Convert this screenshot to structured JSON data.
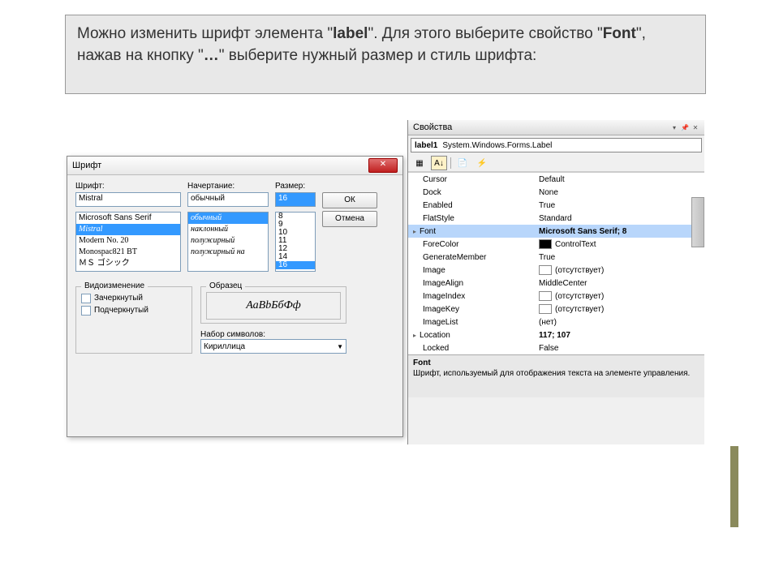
{
  "instruction": {
    "text_before_bold1": "Можно изменить шрифт элемента \"",
    "bold1": "label",
    "text_after_bold1": "\". Для этого выберите свойство \"",
    "bold2": "Font",
    "text_after_bold2": "\", нажав на кнопку \"",
    "bold3": "…",
    "text_end": "\" выберите нужный размер и стиль шрифта:"
  },
  "fontDialog": {
    "title": "Шрифт",
    "fontLabel": "Шрифт:",
    "styleLabel": "Начертание:",
    "sizeLabel": "Размер:",
    "fontInput": "Mistral",
    "styleInput": "обычный",
    "sizeInput": "16",
    "fontList": [
      "Microsoft Sans Serif",
      "Mistral",
      "Modern No. 20",
      "Monospac821 BT",
      "ＭＳ ゴシック"
    ],
    "fontListSelIndex": 1,
    "styleList": [
      "обычный",
      "наклонный",
      "полужирный",
      "полужирный на"
    ],
    "styleListSelIndex": 0,
    "sizeList": [
      "8",
      "9",
      "10",
      "11",
      "12",
      "14",
      "16"
    ],
    "sizeListSelIndex": 6,
    "okBtn": "ОК",
    "cancelBtn": "Отмена",
    "effectsGroup": "Видоизменение",
    "strikeout": "Зачеркнутый",
    "underline": "Подчеркнутый",
    "sampleGroup": "Образец",
    "sampleText": "АаВbБбФф",
    "scriptLabel": "Набор символов:",
    "scriptValue": "Кириллица"
  },
  "properties": {
    "title": "Свойства",
    "selector": {
      "name": "label1",
      "type": "System.Windows.Forms.Label"
    },
    "rows": [
      {
        "name": "Cursor",
        "val": "Default"
      },
      {
        "name": "Dock",
        "val": "None"
      },
      {
        "name": "Enabled",
        "val": "True"
      },
      {
        "name": "FlatStyle",
        "val": "Standard"
      },
      {
        "name": "Font",
        "val": "Microsoft Sans Serif; 8",
        "expand": true,
        "sel": true,
        "bold": true
      },
      {
        "name": "ForeColor",
        "val": "ControlText",
        "swatch": true
      },
      {
        "name": "GenerateMember",
        "val": "True"
      },
      {
        "name": "Image",
        "val": "(отсутствует)",
        "empty": true
      },
      {
        "name": "ImageAlign",
        "val": "MiddleCenter"
      },
      {
        "name": "ImageIndex",
        "val": "(отсутствует)",
        "empty": true
      },
      {
        "name": "ImageKey",
        "val": "(отсутствует)",
        "empty": true
      },
      {
        "name": "ImageList",
        "val": "(нет)"
      },
      {
        "name": "Location",
        "val": "117; 107",
        "expand": true,
        "bold": true
      },
      {
        "name": "Locked",
        "val": "False"
      }
    ],
    "descTitle": "Font",
    "descText": "Шрифт, используемый для отображения текста на элементе управления."
  }
}
